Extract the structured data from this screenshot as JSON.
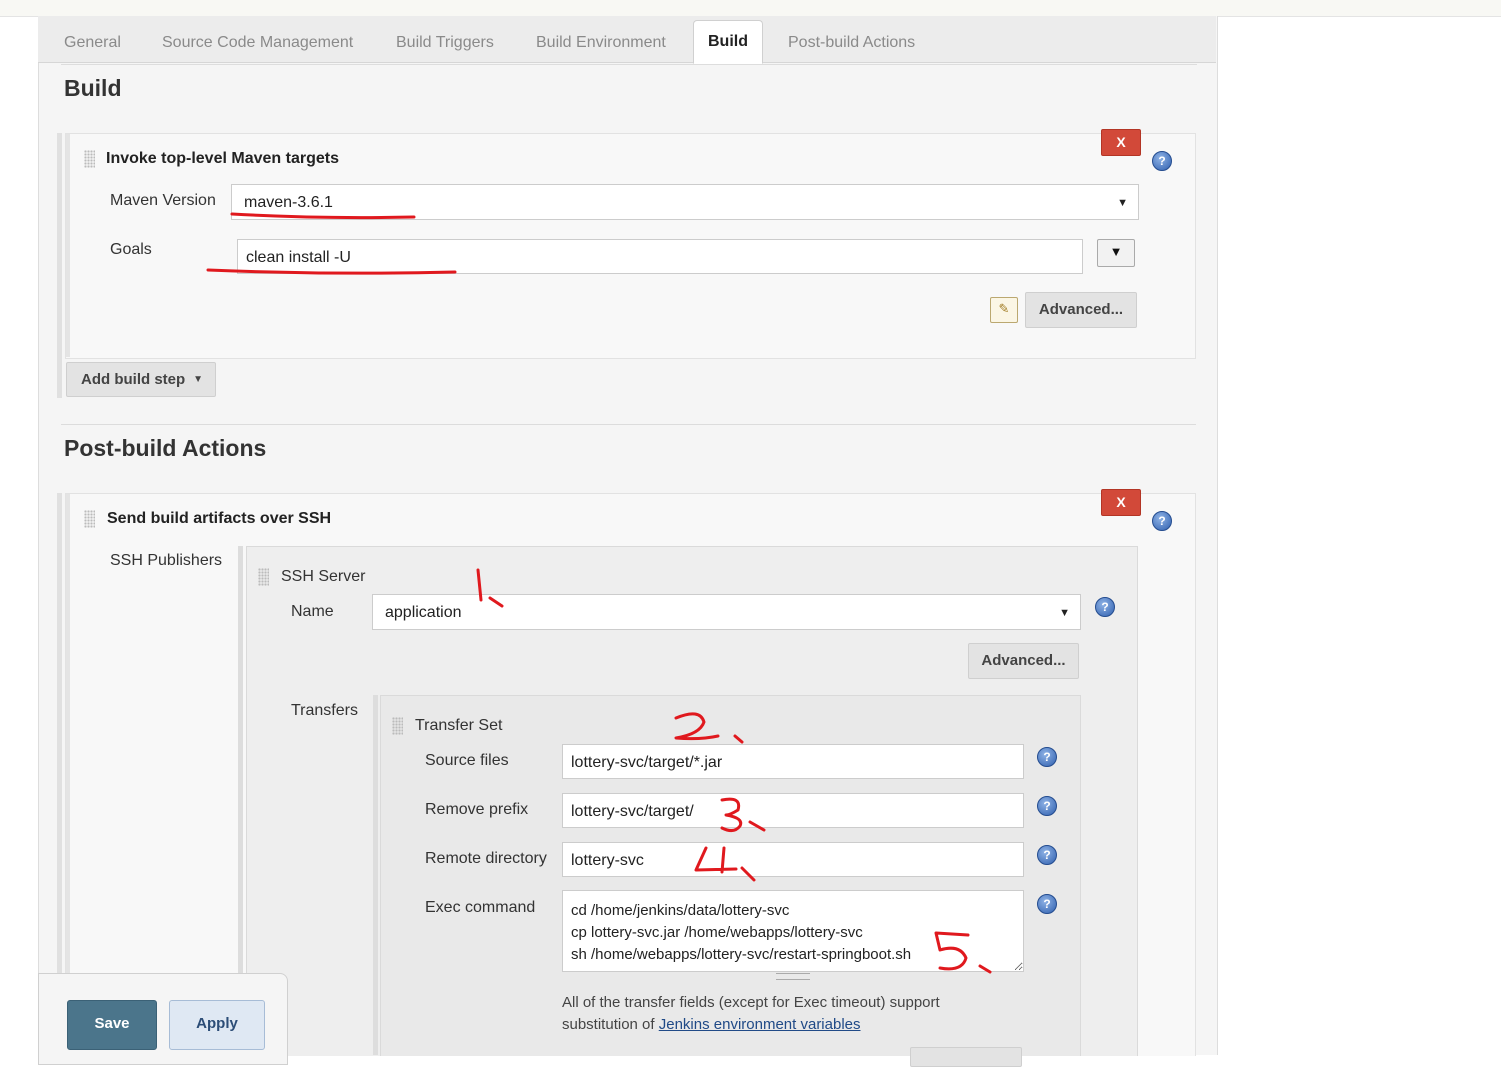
{
  "tabs": [
    "General",
    "Source Code Management",
    "Build Triggers",
    "Build Environment",
    "Build",
    "Post-build Actions"
  ],
  "active_tab": "Build",
  "build": {
    "title": "Build",
    "step": {
      "title": "Invoke top-level Maven targets",
      "remove_label": "X",
      "maven_version_label": "Maven Version",
      "maven_version_value": "maven-3.6.1",
      "goals_label": "Goals",
      "goals_value": "clean install -U",
      "advanced_label": "Advanced..."
    },
    "add_step_label": "Add build step"
  },
  "post_build": {
    "title": "Post-build Actions",
    "step": {
      "title": "Send build artifacts over SSH",
      "remove_label": "X",
      "publishers_label": "SSH Publishers",
      "server": {
        "title": "SSH Server",
        "name_label": "Name",
        "name_value": "application",
        "advanced_label": "Advanced..."
      },
      "transfers_label": "Transfers",
      "transfer_set": {
        "title": "Transfer Set",
        "source_files_label": "Source files",
        "source_files_value": "lottery-svc/target/*.jar",
        "remove_prefix_label": "Remove prefix",
        "remove_prefix_value": "lottery-svc/target/",
        "remote_directory_label": "Remote directory",
        "remote_directory_value": "lottery-svc",
        "exec_command_label": "Exec command",
        "exec_command_value": "cd /home/jenkins/data/lottery-svc\ncp lottery-svc.jar /home/webapps/lottery-svc\nsh /home/webapps/lottery-svc/restart-springboot.sh",
        "note_text": "All of the transfer fields (except for Exec timeout) support substitution of",
        "note_link": "Jenkins environment variables"
      }
    }
  },
  "footer": {
    "save_label": "Save",
    "apply_label": "Apply"
  },
  "annotation_color": "#e0191e",
  "help_icon": "question-mark-circle-icon"
}
